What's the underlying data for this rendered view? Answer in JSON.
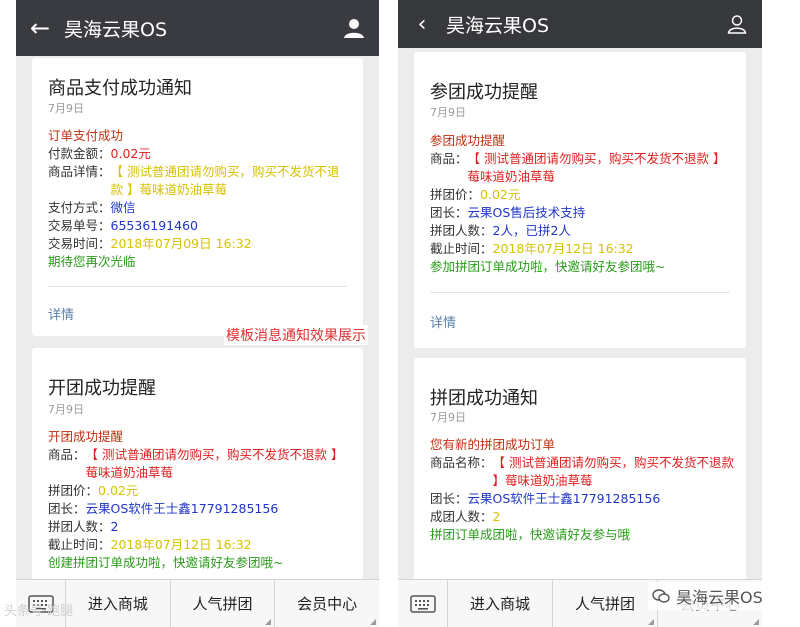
{
  "app_title": "昊海云果OS",
  "caption": "模板消息通知效果展示",
  "watermark_left": "头条号·跑腿",
  "watermark_right": "昊海云果OS",
  "nav": {
    "items": [
      "进入商城",
      "人气拼团",
      "会员中心"
    ]
  },
  "left_cards": [
    {
      "title": "商品支付成功通知",
      "date": "7月9日",
      "head": "订单支付成功",
      "rows": [
        {
          "k": "付款金额：",
          "v": "0.02元"
        },
        {
          "k": "商品详情：",
          "v": "【 测试普通团请勿购买，购买不发货不退款 】莓味道奶油草莓"
        },
        {
          "k": "支付方式：",
          "v": "微信"
        },
        {
          "k": "交易单号：",
          "v": "65536191460"
        },
        {
          "k": "交易时间：",
          "v": "2018年07月09日 16:32"
        }
      ],
      "foot": "期待您再次光临",
      "detail": "详情"
    },
    {
      "title": "开团成功提醒",
      "date": "7月9日",
      "head": "开团成功提醒",
      "rows": [
        {
          "k": "商品：",
          "v": "【 测试普通团请勿购买，购买不发货不退款 】莓味道奶油草莓"
        },
        {
          "k": "拼团价：",
          "v": "0.02元"
        },
        {
          "k": "团长：",
          "v": "云果OS软件王士鑫17791285156"
        },
        {
          "k": "拼团人数：",
          "v": "2"
        },
        {
          "k": "截止时间：",
          "v": "2018年07月12日 16:32"
        }
      ],
      "foot": "创建拼团订单成功啦，快邀请好友参团哦~"
    }
  ],
  "right_cards": [
    {
      "title": "参团成功提醒",
      "date": "7月9日",
      "head": "参团成功提醒",
      "rows": [
        {
          "k": "商品：",
          "v": "【 测试普通团请勿购买，购买不发货不退款 】莓味道奶油草莓"
        },
        {
          "k": "拼团价：",
          "v": "0.02元"
        },
        {
          "k": "团长：",
          "v": "云果OS售后技术支持"
        },
        {
          "k": "拼团人数：",
          "v": "2人，已拼2人"
        },
        {
          "k": "截止时间：",
          "v": "2018年07月12日 16:32"
        }
      ],
      "foot": "参加拼团订单成功啦，快邀请好友参团哦~",
      "detail": "详情"
    },
    {
      "title": "拼团成功通知",
      "date": "7月9日",
      "head": "您有新的拼团成功订单",
      "rows": [
        {
          "k": "商品名称：",
          "v": "【 测试普通团请勿购买，购买不发货不退款 】莓味道奶油草莓"
        },
        {
          "k": "团长：",
          "v": "云果OS软件王士鑫17791285156"
        },
        {
          "k": "成团人数：",
          "v": "2"
        }
      ],
      "foot": "拼团订单成团啦，快邀请好友参与哦"
    }
  ]
}
